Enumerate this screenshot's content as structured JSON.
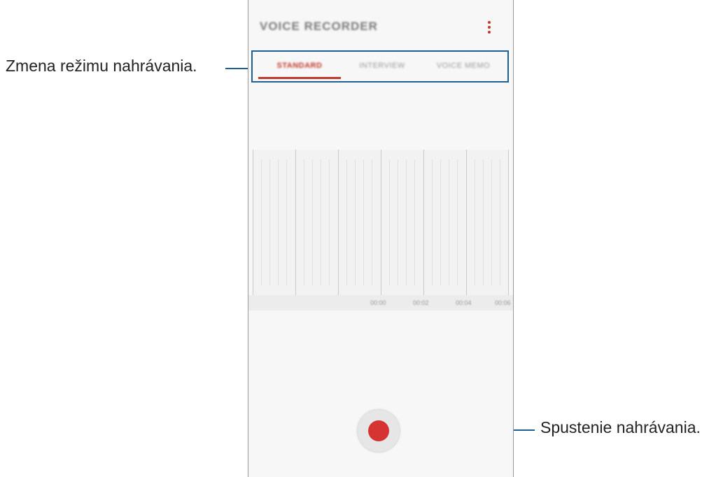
{
  "app": {
    "title": "VOICE RECORDER",
    "menu_icon": "more-vert-icon"
  },
  "tabs": [
    {
      "label": "STANDARD",
      "active": true
    },
    {
      "label": "INTERVIEW",
      "active": false
    },
    {
      "label": "VOICE MEMO",
      "active": false
    }
  ],
  "timeline": {
    "ticks": [
      "00:00",
      "00:02",
      "00:04",
      "00:06"
    ]
  },
  "controls": {
    "record_icon": "record-icon"
  },
  "callouts": {
    "mode": "Zmena režimu nahrávania.",
    "record": "Spustenie nahrávania."
  },
  "colors": {
    "accent": "#c0392b",
    "record": "#d63333",
    "callout_line": "#1f5f93"
  }
}
